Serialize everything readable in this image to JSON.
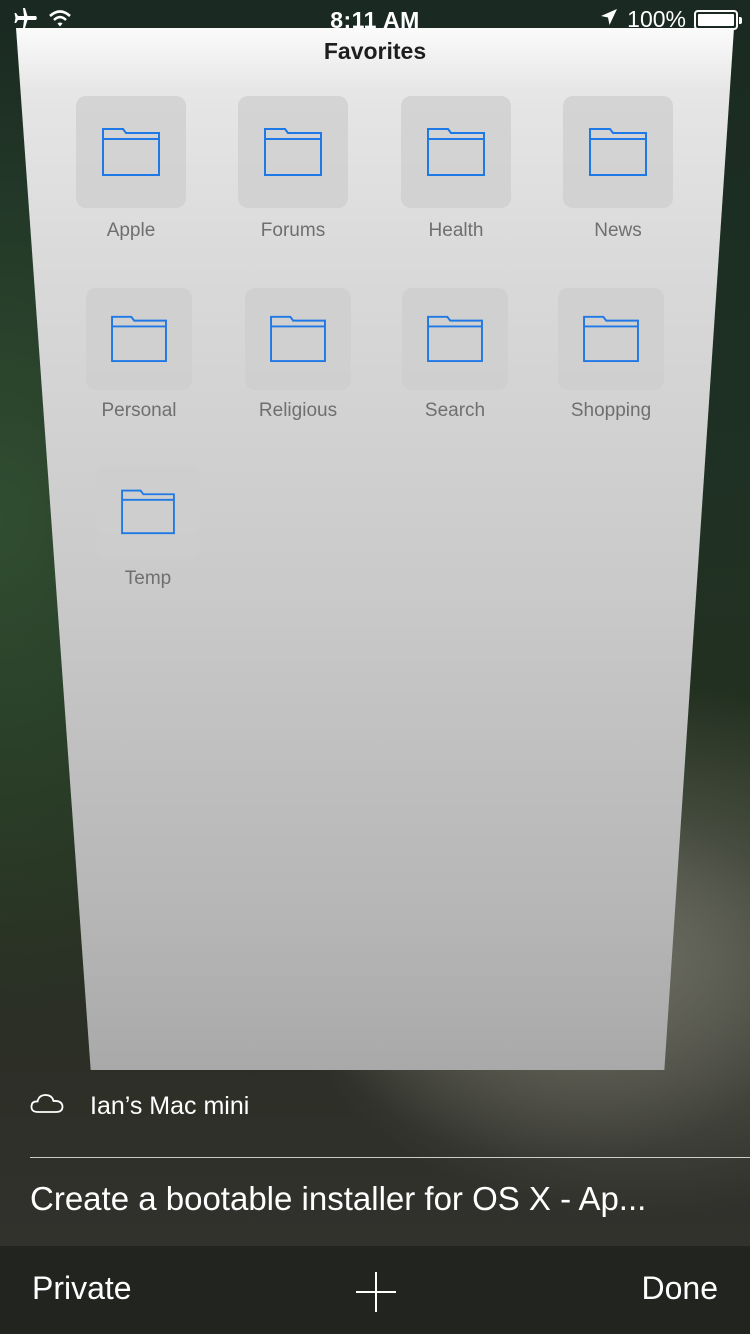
{
  "status_bar": {
    "time": "8:11 AM",
    "battery_percent": "100%",
    "battery_level": 1.0,
    "icons": [
      "airplane-icon",
      "wifi-icon",
      "location-arrow-icon",
      "battery-icon"
    ]
  },
  "tab_card": {
    "title": "Favorites",
    "favorites": [
      {
        "label": "Apple",
        "icon": "folder-icon"
      },
      {
        "label": "Forums",
        "icon": "folder-icon"
      },
      {
        "label": "Health",
        "icon": "folder-icon"
      },
      {
        "label": "News",
        "icon": "folder-icon"
      },
      {
        "label": "Personal",
        "icon": "folder-icon"
      },
      {
        "label": "Religious",
        "icon": "folder-icon"
      },
      {
        "label": "Search",
        "icon": "folder-icon"
      },
      {
        "label": "Shopping",
        "icon": "folder-icon"
      },
      {
        "label": "Temp",
        "icon": "folder-icon"
      }
    ]
  },
  "icloud_tabs": {
    "device_name": "Ian’s Mac mini",
    "tab_title": "Create a bootable installer for OS X - Ap..."
  },
  "toolbar": {
    "private_label": "Private",
    "done_label": "Done"
  },
  "colors": {
    "folder_blue": "#1e78e6",
    "label_gray": "#6f6f6f",
    "text_white": "#ffffff"
  }
}
